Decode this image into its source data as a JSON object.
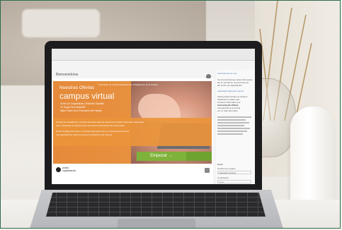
{
  "screen": {
    "welcome": "Bienvenido/as",
    "banner": {
      "pre_title": "Nuestras Ofertas",
      "title": "campus virtual",
      "header_text": "Formación de Central Sindicales de Trabajadores de la Ciudad",
      "sub_lines": [
        "Centro de Capacitación y Estudios Sociales",
        "\"El Hogar Del Estudiante\"",
        "Mejor Futuro de la Formación del Trabajo"
      ],
      "mid_lines": [
        "El portal de capacitación y estudio presentará todas las ofertas de formación Sindicales y Ejecutivas",
        "para el desarrollo de saberes sobre las nuevas herramientas del conocimiento",
        "Desde la página del Centro, encontrará información que es necesaria para conocer",
        "mis capacitaciones, datos de acceso e inscripción a las mismas."
      ],
      "cta": "Empezar →",
      "logo_text": [
        "portal",
        "capacitación"
      ]
    },
    "sidebar": {
      "title": "Instrucciones de uso",
      "texts": [
        "Se recomienda que antes del ingreso",
        "lea el manual de uso del campus",
        "del centro de capacitación",
        "capacitacion@centro.gov.ar",
        "Usted podrá acceder al campus",
        "utilizando los datos que",
        "le fueron informados por",
        "la Inscripción Online",
        "corresponde a la cuenta",
        "con el mail informado"
      ],
      "login_title": "Entrar",
      "user_label": "Nombre de usuario",
      "user_value": "capacitacion.persona",
      "pass_label": "Contraseña",
      "pass_value": "••••••••"
    }
  }
}
